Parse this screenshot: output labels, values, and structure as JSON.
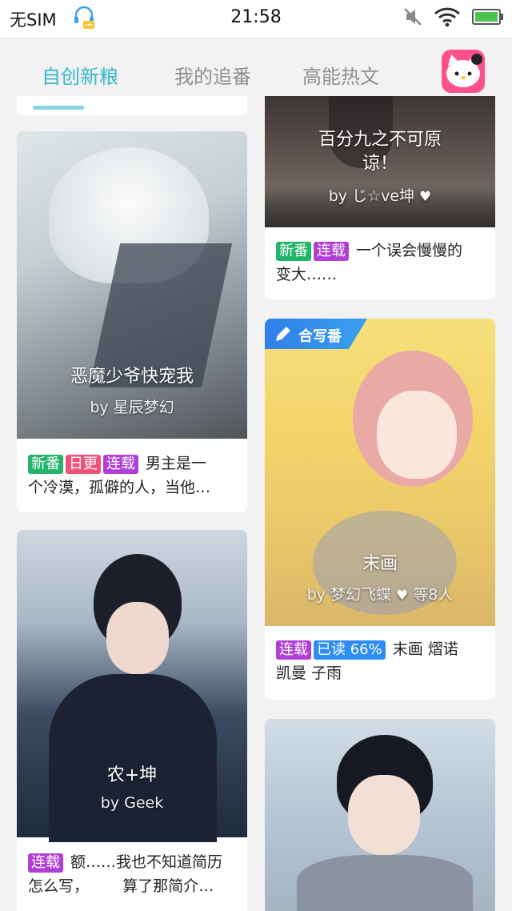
{
  "status_bar": {
    "sim": "无SIM",
    "time": "21:58"
  },
  "tabs": [
    {
      "label": "自创新粮",
      "active": true
    },
    {
      "label": "我的追番",
      "active": false
    },
    {
      "label": "高能热文",
      "active": false
    }
  ],
  "colors": {
    "accent": "#35b8c8",
    "tag_new": "#21b46a",
    "tag_daily": "#f0527a",
    "tag_serial": "#b03fd6",
    "tag_read": "#2e8df2"
  },
  "cards": {
    "top_right": {
      "title_line1": "百分九之不可原",
      "title_line2": "谅！",
      "author": "by じ☆ve坤",
      "tags": [
        "新番",
        "连载"
      ],
      "desc_line1": "一个误会慢慢的",
      "desc_line2": "变大……"
    },
    "left1": {
      "title": "恶魔少爷快宠我",
      "author": "by 星辰梦幻",
      "tags": [
        "新番",
        "日更",
        "连载"
      ],
      "desc_line1": "男主是一",
      "desc_line2": "个冷漠，孤僻的人，当他…"
    },
    "right2": {
      "badge": "合写番",
      "title": "末画",
      "author": "by 梦幻飞蝶",
      "co_authors": "等8人",
      "tags": [
        "连载",
        "已读 66%"
      ],
      "desc_line1": "末画 熠诺",
      "desc_line2": "凯曼 子雨"
    },
    "left2": {
      "title": "农+坤",
      "author": "by Geek",
      "tags": [
        "连载"
      ],
      "desc_line1": "额……我也不知道简历",
      "desc_line2": "怎么写，       算了那简介…"
    }
  }
}
